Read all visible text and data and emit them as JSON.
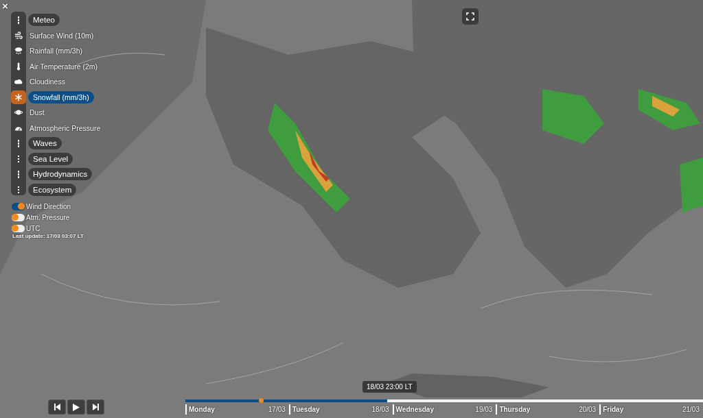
{
  "close_button": {
    "label": "×"
  },
  "layers_menu": [
    {
      "kind": "group",
      "label": "Meteo",
      "selected": false
    },
    {
      "kind": "layer",
      "label": "Surface Wind (10m)",
      "selected": false
    },
    {
      "kind": "layer",
      "label": "Rainfall (mm/3h)",
      "selected": false
    },
    {
      "kind": "layer",
      "label": "Air Temperature (2m)",
      "selected": false
    },
    {
      "kind": "layer",
      "label": "Cloudiness",
      "selected": false
    },
    {
      "kind": "layer",
      "label": "Snowfall (mm/3h)",
      "selected": true
    },
    {
      "kind": "layer",
      "label": "Dust",
      "selected": false
    },
    {
      "kind": "layer",
      "label": "Atmospheric Pressure",
      "selected": false
    },
    {
      "kind": "group",
      "label": "Waves",
      "selected": false
    },
    {
      "kind": "group",
      "label": "Sea Level",
      "selected": false
    },
    {
      "kind": "group",
      "label": "Hydrodynamics",
      "selected": false
    },
    {
      "kind": "group",
      "label": "Ecosystem",
      "selected": false
    }
  ],
  "toggles": [
    {
      "label": "Wind Direction",
      "on": true
    },
    {
      "label": "Atm. Pressure",
      "on": false
    },
    {
      "label": "UTC",
      "on": false
    }
  ],
  "last_update": "Last update: 17/03 03:07 LT",
  "timeline": {
    "tooltip": "18/03 23:00 LT",
    "level": 0.39,
    "days": [
      {
        "day": "Monday",
        "date": "17/03"
      },
      {
        "day": "Tuesday",
        "date": "18/03"
      },
      {
        "day": "Wednesday",
        "date": "19/03"
      },
      {
        "day": "Thursday",
        "date": "20/03"
      },
      {
        "day": "Friday",
        "date": "21/03"
      }
    ]
  }
}
